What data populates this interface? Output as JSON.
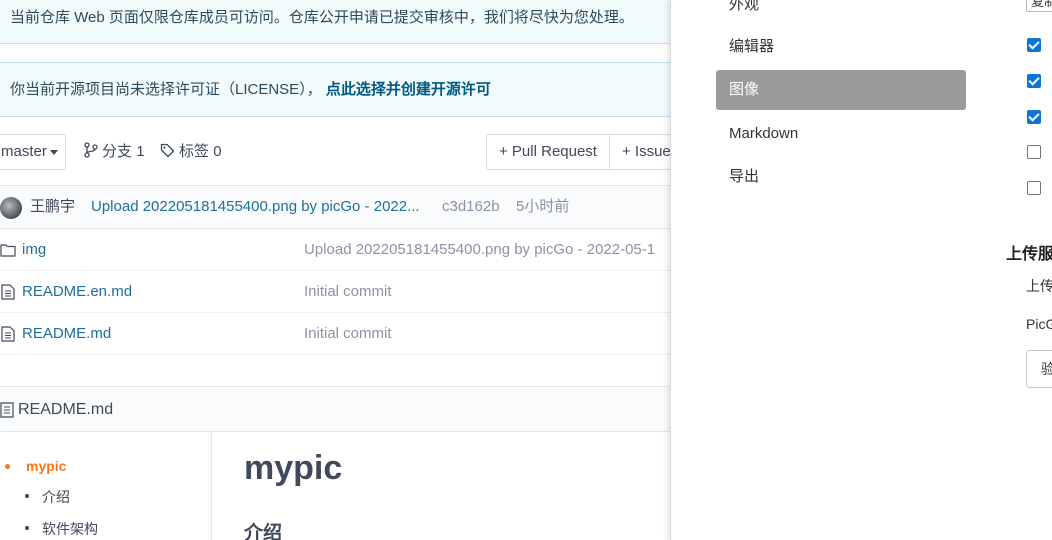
{
  "notice": {
    "review_text": "当前仓库 Web 页面仅限仓库成员可访问。仓库公开申请已提交审核中，我们将尽快为您处理。",
    "license_text": "你当前开源项目尚未选择许可证（LICENSE），",
    "license_link": "点此选择并创建开源许可"
  },
  "toolbar": {
    "branch": "master",
    "branches_label": "分支",
    "branches_count": "1",
    "tags_label": "标签",
    "tags_count": "0",
    "pull_request": "+ Pull Request",
    "issue": "+ Issue"
  },
  "last_commit": {
    "author": "王鹏宇",
    "message": "Upload 202205181455400.png by picGo - 2022...",
    "sha": "c3d162b",
    "time": "5小时前"
  },
  "files": [
    {
      "name": "img",
      "type": "folder",
      "message": "Upload 202205181455400.png by picGo - 2022-05-1"
    },
    {
      "name": "README.en.md",
      "type": "file",
      "message": "Initial commit"
    },
    {
      "name": "README.md",
      "type": "file",
      "message": "Initial commit"
    }
  ],
  "readme": {
    "filename": "README.md",
    "toc": [
      "mypic",
      "介绍",
      "软件架构"
    ],
    "h1": "mypic",
    "h2": "介绍"
  },
  "settings": {
    "nav": [
      "外观",
      "编辑器",
      "图像",
      "Markdown",
      "导出"
    ],
    "active_nav": "图像",
    "select_fragment": "复制",
    "checkboxes": [
      true,
      true,
      true,
      false,
      false
    ],
    "section_title": "上传服",
    "upload_label": "上传",
    "picgo_label": "PicG",
    "verify_button": "验"
  },
  "colors": {
    "accent_link": "#005980",
    "file_link": "#1e6f9b",
    "toc_active": "#f07a22",
    "nav_active_bg": "#9a9a9a",
    "checkbox_on": "#0b76d6"
  }
}
